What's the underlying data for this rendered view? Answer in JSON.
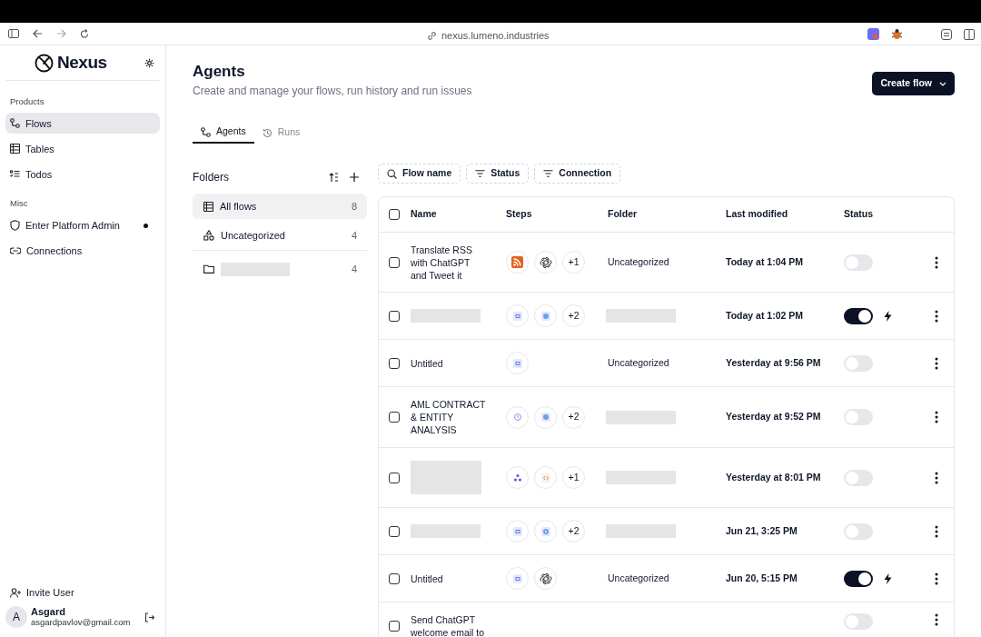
{
  "browser": {
    "url": "nexus.lumeno.industries"
  },
  "sidebar": {
    "brand": "Nexus",
    "sections": [
      {
        "title": "Products",
        "items": [
          {
            "label": "Flows",
            "selected": true,
            "dot": false
          },
          {
            "label": "Tables",
            "selected": false,
            "dot": false
          },
          {
            "label": "Todos",
            "selected": false,
            "dot": false
          }
        ]
      },
      {
        "title": "Misc",
        "items": [
          {
            "label": "Enter Platform Admin",
            "selected": false,
            "dot": true
          },
          {
            "label": "Connections",
            "selected": false,
            "dot": false
          }
        ]
      }
    ],
    "invite": "Invite User",
    "user": {
      "initial": "A",
      "name": "Asgard",
      "email": "asgardpavlov@gmail.com"
    }
  },
  "header": {
    "title": "Agents",
    "subtitle": "Create and manage your flows, run history and run issues",
    "create_button": "Create flow"
  },
  "tabs": [
    {
      "label": "Agents",
      "selected": true
    },
    {
      "label": "Runs",
      "selected": false
    }
  ],
  "folders": {
    "title": "Folders",
    "items": [
      {
        "label": "All flows",
        "count": "8",
        "selected": true
      },
      {
        "label": "Uncategorized",
        "count": "4",
        "selected": false
      },
      {
        "count": "4",
        "selected": false,
        "redacted": true
      }
    ]
  },
  "filters": [
    {
      "label": "Flow name",
      "kind": "search"
    },
    {
      "label": "Status",
      "kind": "filter"
    },
    {
      "label": "Connection",
      "kind": "filter"
    }
  ],
  "table": {
    "all_checked": false,
    "columns": [
      "Name",
      "Steps",
      "Folder",
      "Last modified",
      "Status"
    ],
    "rows": [
      {
        "checked": false,
        "name": "Translate RSS with ChatGPT and Tweet it",
        "steps": [
          {
            "kind": "rss"
          },
          {
            "kind": "openai"
          },
          {
            "kind": "count",
            "label": "+1"
          }
        ],
        "folder": "Uncategorized",
        "modified": "Today at 1:04 PM",
        "enabled": false
      },
      {
        "checked": false,
        "name_redacted": true,
        "steps": [
          {
            "kind": "app"
          },
          {
            "kind": "globe"
          },
          {
            "kind": "count",
            "label": "+2"
          }
        ],
        "folder_redacted": true,
        "modified": "Today at 1:02 PM",
        "enabled": true
      },
      {
        "checked": false,
        "name": "Untitled",
        "steps": [
          {
            "kind": "app"
          }
        ],
        "folder": "Uncategorized",
        "modified": "Yesterday at 9:56 PM",
        "enabled": false
      },
      {
        "checked": false,
        "name": "AML CONTRACT & ENTITY ANALYSIS",
        "steps": [
          {
            "kind": "clock"
          },
          {
            "kind": "globe"
          },
          {
            "kind": "count",
            "label": "+2"
          }
        ],
        "folder_redacted": true,
        "modified": "Yesterday at 9:52 PM",
        "enabled": false
      },
      {
        "checked": false,
        "name_redacted": true,
        "steps": [
          {
            "kind": "nodes"
          },
          {
            "kind": "code"
          },
          {
            "kind": "count",
            "label": "+1"
          }
        ],
        "folder_redacted": true,
        "modified": "Yesterday at 8:01 PM",
        "enabled": false
      },
      {
        "checked": false,
        "name_redacted": true,
        "steps": [
          {
            "kind": "app"
          },
          {
            "kind": "play"
          },
          {
            "kind": "count",
            "label": "+2"
          }
        ],
        "folder_redacted": true,
        "modified": "Jun 21, 3:25 PM",
        "enabled": false
      },
      {
        "checked": false,
        "name": "Untitled",
        "steps": [
          {
            "kind": "app"
          },
          {
            "kind": "openai"
          }
        ],
        "folder": "Uncategorized",
        "modified": "Jun 20, 5:15 PM",
        "enabled": true
      },
      {
        "checked": false,
        "name": "Send ChatGPT welcome email to",
        "steps": [],
        "enabled": false
      }
    ]
  }
}
